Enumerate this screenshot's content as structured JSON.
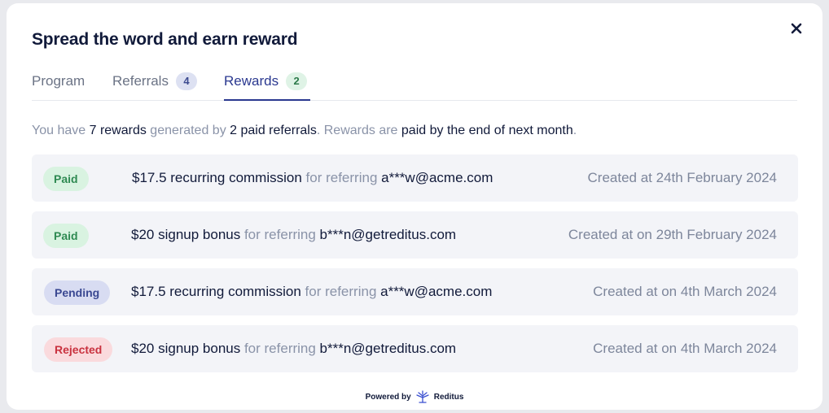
{
  "title": "Spread the word and earn reward",
  "tabs": [
    {
      "label": "Program"
    },
    {
      "label": "Referrals",
      "count": "4"
    },
    {
      "label": "Rewards",
      "count": "2"
    }
  ],
  "summary": {
    "p1": "You have ",
    "rewards": "7 rewards",
    "p2": " generated by ",
    "referrals": "2 paid referrals",
    "p3": ". Rewards are ",
    "paid": "paid by the end of next month",
    "p4": "."
  },
  "rewards": [
    {
      "status": "Paid",
      "amount": "$17.5 recurring commission",
      "for": " for referring ",
      "email": "a***w@acme.com",
      "created": "Created at 24th February 2024"
    },
    {
      "status": "Paid",
      "amount": "$20 signup bonus",
      "for": " for referring ",
      "email": "b***n@getreditus.com",
      "created": "Created at on 29th February 2024"
    },
    {
      "status": "Pending",
      "amount": "$17.5 recurring commission",
      "for": " for referring ",
      "email": "a***w@acme.com",
      "created": "Created at on 4th March 2024"
    },
    {
      "status": "Rejected",
      "amount": "$20 signup bonus",
      "for": " for referring ",
      "email": "b***n@getreditus.com",
      "created": "Created at on 4th March 2024"
    }
  ],
  "footer": {
    "powered_by": "Powered by",
    "brand": "Reditus"
  },
  "icons": {
    "close": "close-icon",
    "brand_logo": "reditus-logo-icon"
  },
  "colors": {
    "accent": "#2b3990",
    "paid": "#2f8a52",
    "pending": "#3a4892",
    "rejected": "#c9323f"
  }
}
